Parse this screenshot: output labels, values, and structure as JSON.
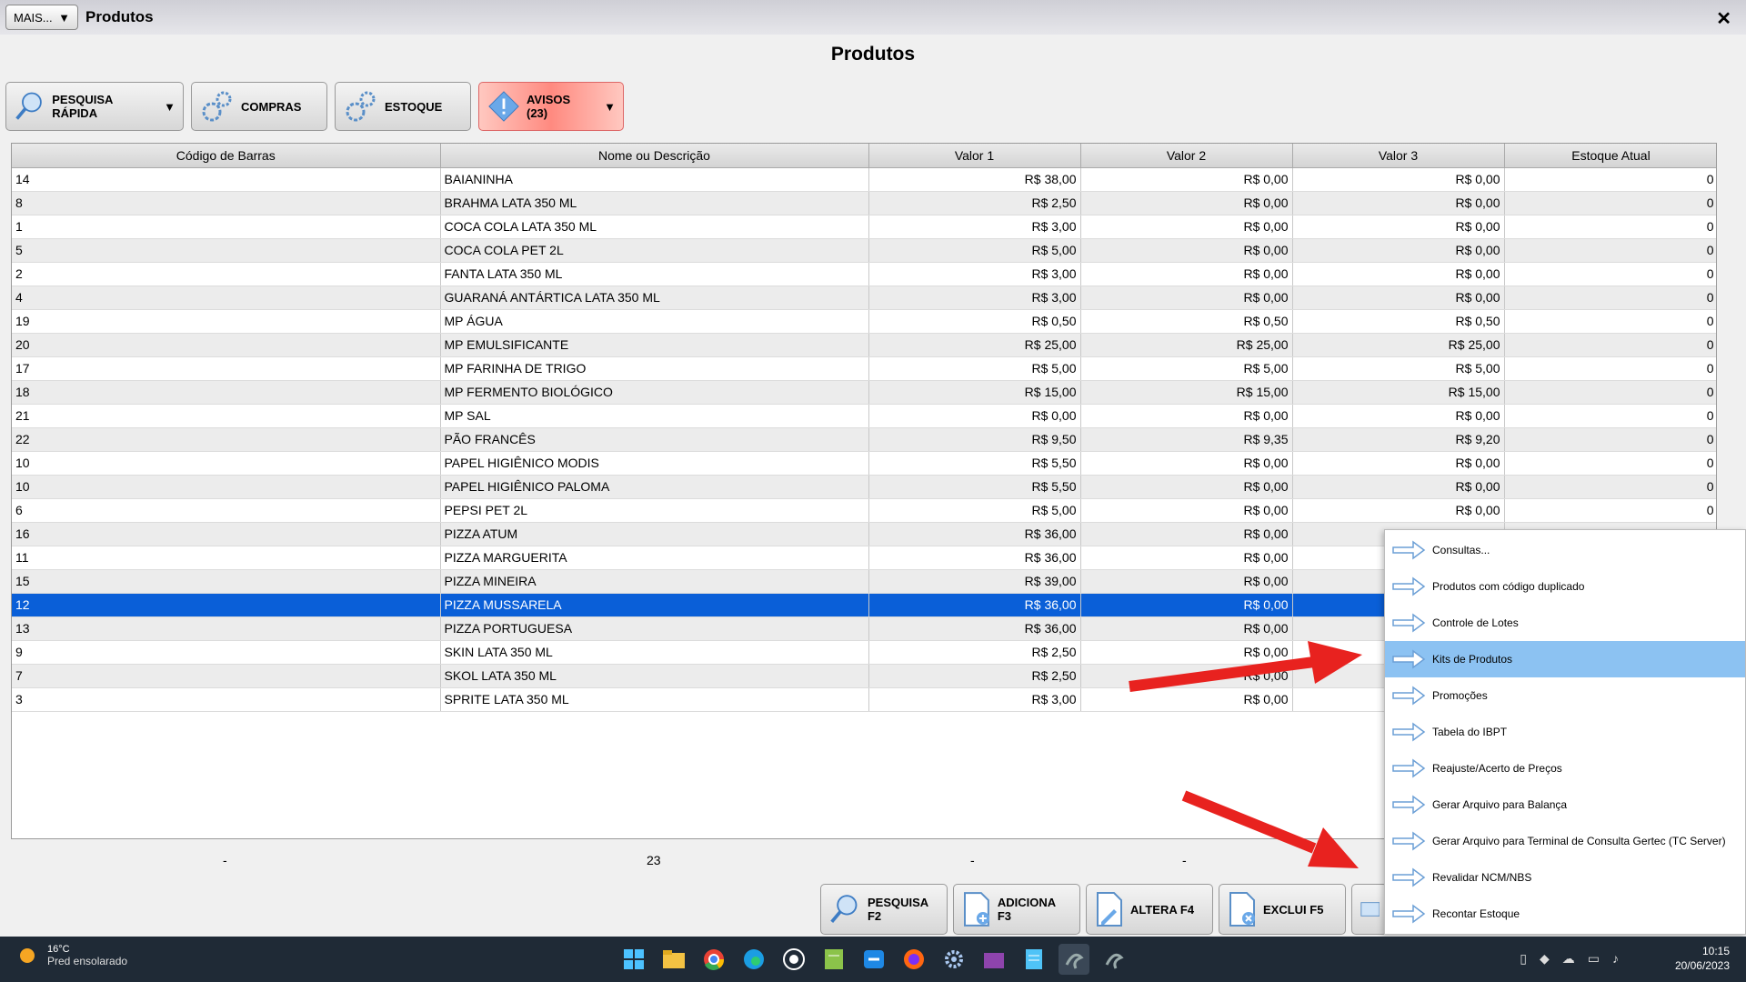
{
  "window": {
    "more_label": "MAIS...",
    "title": "Produtos",
    "close": "✕"
  },
  "heading": "Produtos",
  "toolbar": {
    "quick_search": "PESQUISA RÁPIDA",
    "purchases": "COMPRAS",
    "stock": "ESTOQUE",
    "warnings": "AVISOS (23)"
  },
  "table": {
    "columns": [
      "Código de Barras",
      "Nome ou Descrição",
      "Valor 1",
      "Valor 2",
      "Valor 3",
      "Estoque Atual"
    ],
    "rows": [
      [
        "14",
        "BAIANINHA",
        "R$ 38,00",
        "R$ 0,00",
        "R$ 0,00",
        "0"
      ],
      [
        "8",
        "BRAHMA LATA 350 ML",
        "R$ 2,50",
        "R$ 0,00",
        "R$ 0,00",
        "0"
      ],
      [
        "1",
        "COCA COLA LATA 350 ML",
        "R$ 3,00",
        "R$ 0,00",
        "R$ 0,00",
        "0"
      ],
      [
        "5",
        "COCA COLA PET 2L",
        "R$ 5,00",
        "R$ 0,00",
        "R$ 0,00",
        "0"
      ],
      [
        "2",
        "FANTA LATA 350 ML",
        "R$ 3,00",
        "R$ 0,00",
        "R$ 0,00",
        "0"
      ],
      [
        "4",
        "GUARANÁ ANTÁRTICA LATA 350 ML",
        "R$ 3,00",
        "R$ 0,00",
        "R$ 0,00",
        "0"
      ],
      [
        "19",
        "MP ÁGUA",
        "R$ 0,50",
        "R$ 0,50",
        "R$ 0,50",
        "0"
      ],
      [
        "20",
        "MP EMULSIFICANTE",
        "R$ 25,00",
        "R$ 25,00",
        "R$ 25,00",
        "0"
      ],
      [
        "17",
        "MP FARINHA DE TRIGO",
        "R$ 5,00",
        "R$ 5,00",
        "R$ 5,00",
        "0"
      ],
      [
        "18",
        "MP FERMENTO BIOLÓGICO",
        "R$ 15,00",
        "R$ 15,00",
        "R$ 15,00",
        "0"
      ],
      [
        "21",
        "MP SAL",
        "R$ 0,00",
        "R$ 0,00",
        "R$ 0,00",
        "0"
      ],
      [
        "22",
        "PÃO FRANCÊS",
        "R$ 9,50",
        "R$ 9,35",
        "R$ 9,20",
        "0"
      ],
      [
        "10",
        "PAPEL HIGIÊNICO MODIS",
        "R$ 5,50",
        "R$ 0,00",
        "R$ 0,00",
        "0"
      ],
      [
        "10",
        "PAPEL HIGIÊNICO PALOMA",
        "R$ 5,50",
        "R$ 0,00",
        "R$ 0,00",
        "0"
      ],
      [
        "6",
        "PEPSI PET 2L",
        "R$ 5,00",
        "R$ 0,00",
        "R$ 0,00",
        "0"
      ],
      [
        "16",
        "PIZZA ATUM",
        "R$ 36,00",
        "R$ 0,00",
        "",
        ""
      ],
      [
        "11",
        "PIZZA MARGUERITA",
        "R$ 36,00",
        "R$ 0,00",
        "",
        ""
      ],
      [
        "15",
        "PIZZA MINEIRA",
        "R$ 39,00",
        "R$ 0,00",
        "",
        ""
      ],
      [
        "12",
        "PIZZA MUSSARELA",
        "R$ 36,00",
        "R$ 0,00",
        "",
        ""
      ],
      [
        "13",
        "PIZZA PORTUGUESA",
        "R$ 36,00",
        "R$ 0,00",
        "",
        ""
      ],
      [
        "9",
        "SKIN LATA 350 ML",
        "R$ 2,50",
        "R$ 0,00",
        "",
        ""
      ],
      [
        "7",
        "SKOL LATA 350 ML",
        "R$ 2,50",
        "R$ 0,00",
        "",
        ""
      ],
      [
        "3",
        "SPRITE LATA 350 ML",
        "R$ 3,00",
        "R$ 0,00",
        "",
        ""
      ]
    ],
    "selected_row": 18
  },
  "totals": {
    "col1": "-",
    "count": "23",
    "col3": "-",
    "col4": "-"
  },
  "bottom": {
    "search": "PESQUISA F2",
    "add": "ADICIONA F3",
    "edit": "ALTERA F4",
    "delete": "EXCLUI F5"
  },
  "menu": {
    "items": [
      "Consultas...",
      "Produtos com código duplicado",
      "Controle de Lotes",
      "Kits de Produtos",
      "Promoções",
      "Tabela do IBPT",
      "Reajuste/Acerto de Preços",
      "Gerar Arquivo para Balança",
      "Gerar Arquivo para Terminal de Consulta Gertec (TC Server)",
      "Revalidar NCM/NBS",
      "Recontar Estoque"
    ],
    "highlighted": 3
  },
  "taskbar": {
    "temp": "16°C",
    "weather": "Pred ensolarado",
    "time": "10:15",
    "date": "20/06/2023"
  },
  "colors": {
    "selection": "#0a5fd8",
    "menu_highlight": "#8cc2f2",
    "warning": "#ff8a80"
  }
}
